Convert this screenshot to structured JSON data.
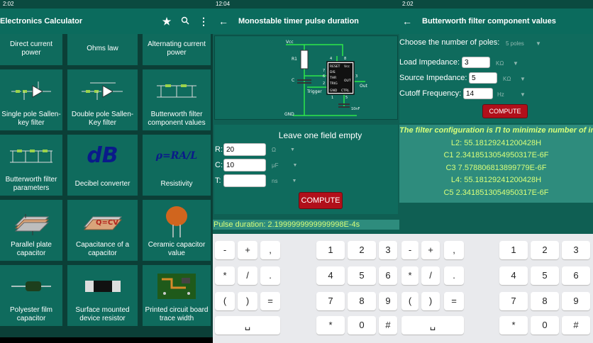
{
  "screen1": {
    "status_time": "2:02",
    "title": "Electronics Calculator",
    "icons": [
      "star-icon",
      "search-icon",
      "more-vert-icon"
    ],
    "tiles": [
      {
        "label": "Direct current power",
        "pic": "none"
      },
      {
        "label": "Ohms law",
        "pic": "none"
      },
      {
        "label": "Alternating current power",
        "pic": "none"
      },
      {
        "label": "Single pole Sallen-key filter",
        "pic": "circuit-icon"
      },
      {
        "label": "Double pole Sallen-Key filter",
        "pic": "circuit-icon"
      },
      {
        "label": "Butterworth filter component values",
        "pic": "ladder-icon"
      },
      {
        "label": "Butterworth filter parameters",
        "pic": "ladder-icon"
      },
      {
        "label": "Decibel converter",
        "pic": "dB"
      },
      {
        "label": "Resistivity",
        "pic": "ρ=RA/L"
      },
      {
        "label": "Parallel plate capacitor",
        "pic": "plate-icon"
      },
      {
        "label": "Capacitance of a capacitor",
        "pic": "Q=CV"
      },
      {
        "label": "Ceramic capacitor value",
        "pic": "ceramic-icon"
      },
      {
        "label": "Polyester film capacitor",
        "pic": "film-icon"
      },
      {
        "label": "Surface mounted device resistor",
        "pic": "smd-icon"
      },
      {
        "label": "Printed circuit board trace width",
        "pic": "pcb-icon"
      }
    ]
  },
  "screen2": {
    "status_time": "12:04",
    "title": "Monostable timer pulse duration",
    "circuit_labels": {
      "vcc": "Vcc",
      "r1": "R1",
      "c": "C",
      "gnd": "GND",
      "out": "Out",
      "trigger": "Trigger",
      "cap": "10nF",
      "reset": "RESET",
      "vcc2": "Vcc",
      "dis": "DIS",
      "thr": "THR",
      "trig": "TRIG",
      "gnd2": "GND",
      "ctrl": "CTRL",
      "p4": "4",
      "p8": "8",
      "p3": "3",
      "p7": "7",
      "p6": "6",
      "p2": "2",
      "p1": "1",
      "p5": "5"
    },
    "hint": "Leave one field empty",
    "fields": [
      {
        "label": "R:",
        "value": "20",
        "unit": "Ω"
      },
      {
        "label": "C:",
        "value": "10",
        "unit": "μF"
      },
      {
        "label": "T:",
        "value": "",
        "unit": "ns"
      }
    ],
    "compute": "COMPUTE",
    "result": "Pulse duration: 2.1999999999999998E-4s"
  },
  "screen3": {
    "status_time": "2:02",
    "title": "Butterworth filter component values",
    "poles_label": "Choose the number of poles:",
    "poles_value": "5 poles",
    "load_label": "Load Impedance:",
    "load_value": "3",
    "load_unit": "KΩ",
    "source_label": "Source Impedance:",
    "source_value": "5",
    "source_unit": "KΩ",
    "cutoff_label": "Cutoff Frequency:",
    "cutoff_value": "14",
    "cutoff_unit": "Hz",
    "compute": "COMPUTE",
    "config": "The filter configuration is Π to minimize number of indu",
    "results": [
      "L2: 55.18129241200428H",
      "C1 2.3418513054950317E-6F",
      "C3 7.578806813899779E-6F",
      "L4: 55.18129241200428H",
      "C5 2.3418513054950317E-6F"
    ]
  },
  "keyboard": {
    "sym_keys": [
      "-",
      "+",
      ",",
      "*",
      "/",
      ".",
      "(",
      ")",
      "=",
      "␣"
    ],
    "num_keys": [
      "1",
      "2",
      "3",
      "4",
      "5",
      "6",
      "7",
      "8",
      "9",
      "*",
      "0",
      "#"
    ]
  }
}
